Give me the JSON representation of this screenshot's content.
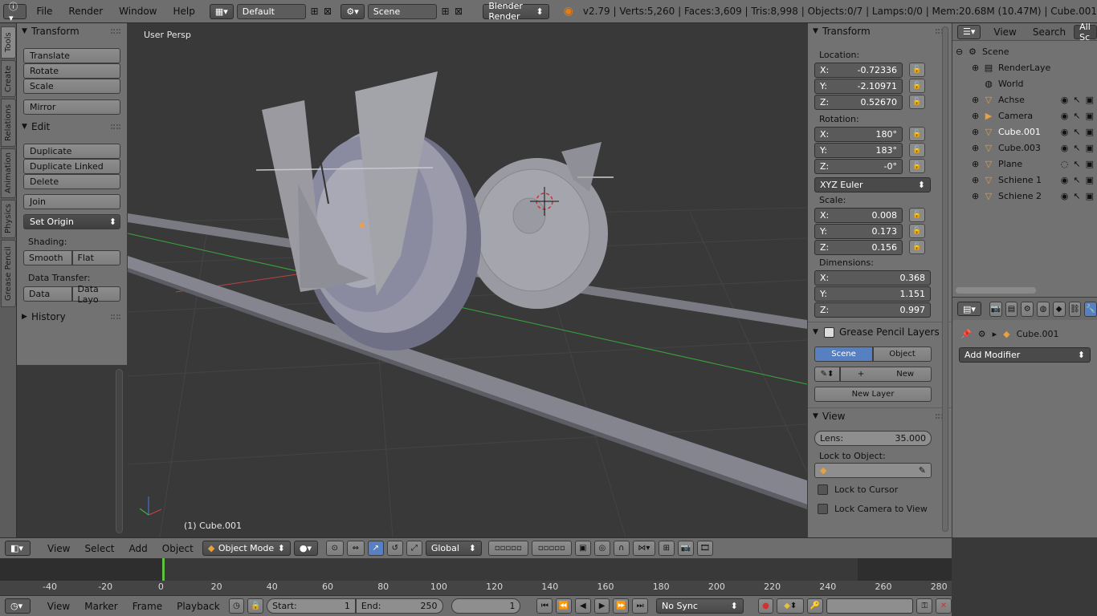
{
  "topbar": {
    "menus": [
      "File",
      "Render",
      "Window",
      "Help"
    ],
    "screen_layout": "Default",
    "scene": "Scene",
    "render_engine": "Blender Render",
    "stats": "v2.79 | Verts:5,260 | Faces:3,609 | Tris:8,998 | Objects:0/7 | Lamps:0/0 | Mem:20.68M (10.47M) | Cube.001"
  },
  "tabs": [
    "Tools",
    "Create",
    "Relations",
    "Animation",
    "Physics",
    "Grease Pencil"
  ],
  "shelf": {
    "transform_title": "Transform",
    "translate": "Translate",
    "rotate": "Rotate",
    "scale": "Scale",
    "mirror": "Mirror",
    "edit_title": "Edit",
    "duplicate": "Duplicate",
    "duplicate_linked": "Duplicate Linked",
    "delete": "Delete",
    "join": "Join",
    "set_origin": "Set Origin",
    "shading_label": "Shading:",
    "smooth": "Smooth",
    "flat": "Flat",
    "data_transfer_label": "Data Transfer:",
    "data": "Data",
    "data_layout": "Data Layo",
    "history_title": "History"
  },
  "viewport": {
    "view_label": "User Persp",
    "object_label": "(1) Cube.001"
  },
  "npanel": {
    "transform_title": "Transform",
    "location_label": "Location:",
    "location": {
      "x": "-0.72336",
      "y": "-2.10971",
      "z": "0.52670"
    },
    "rotation_label": "Rotation:",
    "rotation": {
      "x": "180°",
      "y": "183°",
      "z": "-0°"
    },
    "rotation_mode": "XYZ Euler",
    "scale_label": "Scale:",
    "scale": {
      "x": "0.008",
      "y": "0.173",
      "z": "0.156"
    },
    "dimensions_label": "Dimensions:",
    "dimensions": {
      "x": "0.368",
      "y": "1.151",
      "z": "0.997"
    },
    "gp_title": "Grease Pencil Layers",
    "gp_scene": "Scene",
    "gp_object": "Object",
    "gp_new": "New",
    "gp_new_layer": "New Layer",
    "view_title": "View",
    "lens_label": "Lens:",
    "lens_value": "35.000",
    "lock_object_label": "Lock to Object:",
    "lock_cursor": "Lock to Cursor",
    "lock_camera": "Lock Camera to View",
    "axis_x": "X:",
    "axis_y": "Y:",
    "axis_z": "Z:"
  },
  "outliner": {
    "view": "View",
    "search": "Search",
    "filter": "All Sc",
    "items": [
      {
        "name": "Scene",
        "icon": "scene-icon"
      },
      {
        "name": "RenderLaye",
        "icon": "render-layer-icon"
      },
      {
        "name": "World",
        "icon": "world-icon"
      },
      {
        "name": "Achse",
        "icon": "mesh-icon"
      },
      {
        "name": "Camera",
        "icon": "camera-icon"
      },
      {
        "name": "Cube.001",
        "icon": "mesh-icon"
      },
      {
        "name": "Cube.003",
        "icon": "mesh-icon"
      },
      {
        "name": "Plane",
        "icon": "mesh-icon"
      },
      {
        "name": "Schiene 1",
        "icon": "mesh-icon"
      },
      {
        "name": "Schiene 2",
        "icon": "mesh-icon"
      }
    ]
  },
  "properties": {
    "object_name": "Cube.001",
    "add_modifier": "Add Modifier"
  },
  "viewport_header": {
    "menus": [
      "View",
      "Select",
      "Add",
      "Object"
    ],
    "mode": "Object Mode",
    "orientation": "Global"
  },
  "timeline": {
    "ticks": [
      "-40",
      "-20",
      "0",
      "20",
      "40",
      "60",
      "80",
      "100",
      "120",
      "140",
      "160",
      "180",
      "200",
      "220",
      "240",
      "260",
      "280"
    ],
    "menus": [
      "View",
      "Marker",
      "Frame",
      "Playback"
    ],
    "start_label": "Start:",
    "start": "1",
    "end_label": "End:",
    "end": "250",
    "current": "1",
    "sync": "No Sync"
  },
  "colors": {
    "accent_blue": "#5680c2",
    "selected_orange": "#f0a040",
    "green_axis": "#3aa83a",
    "red_axis": "#b84444",
    "frame_marker": "#60c040"
  }
}
